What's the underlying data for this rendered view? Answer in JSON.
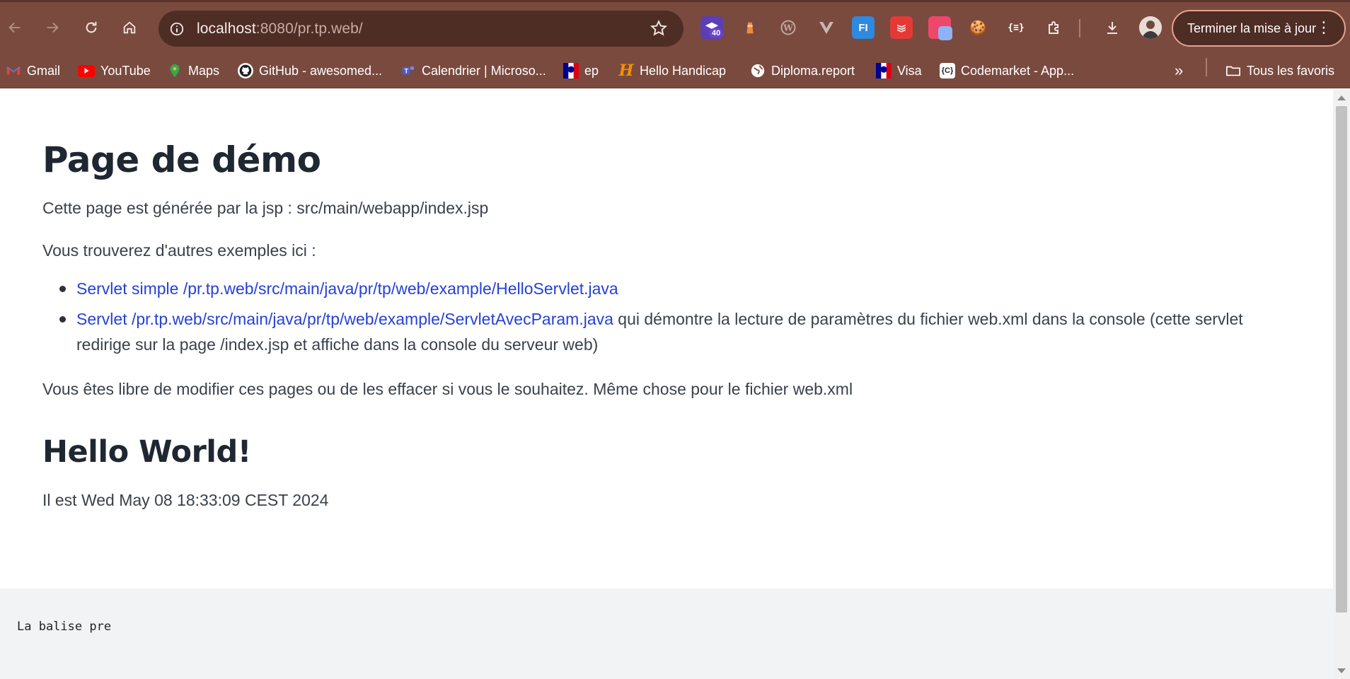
{
  "browser": {
    "url_host": "localhost",
    "url_rest": ":8080/pr.tp.web/",
    "extension_badge": "40",
    "update_button_label": "Terminer la mise à jour",
    "colors": {
      "chrome": "#7a4a3f",
      "omnibox": "#4e2d25",
      "update_border": "#e9a18f"
    }
  },
  "bookmarks": {
    "items": [
      {
        "label": "Gmail",
        "icon": "gmail-icon"
      },
      {
        "label": "YouTube",
        "icon": "youtube-icon"
      },
      {
        "label": "Maps",
        "icon": "maps-icon"
      },
      {
        "label": "GitHub - awesomed...",
        "icon": "github-icon"
      },
      {
        "label": "Calendrier | Microso...",
        "icon": "teams-icon"
      },
      {
        "label": "ep",
        "icon": "marianne-icon"
      },
      {
        "label": "Hello Handicap",
        "icon": "hello-handicap-icon"
      },
      {
        "label": "Diploma.report",
        "icon": "globe-icon"
      },
      {
        "label": "Visa",
        "icon": "marianne-icon"
      },
      {
        "label": "Codemarket - App...",
        "icon": "codemarket-icon"
      }
    ],
    "overflow": "»",
    "all_bookmarks_label": "Tous les favoris"
  },
  "page": {
    "title": "Page de démo",
    "intro": "Cette page est générée par la jsp : src/main/webapp/index.jsp",
    "examples_intro": "Vous trouverez d'autres exemples ici :",
    "links": [
      {
        "text": "Servlet simple /pr.tp.web/src/main/java/pr/tp/web/example/HelloServlet.java",
        "suffix": ""
      },
      {
        "text": "Servlet /pr.tp.web/src/main/java/pr/tp/web/example/ServletAvecParam.java",
        "suffix": " qui démontre la lecture de paramètres du fichier web.xml dans la console (cette servlet redirige sur la page /index.jsp et affiche dans la console du serveur web)"
      }
    ],
    "freedom_note": "Vous êtes libre de modifier ces pages ou de les effacer si vous le souhaitez. Même chose pour le fichier web.xml",
    "hello_heading": "Hello World!",
    "date_line": "Il est Wed May 08 18:33:09 CEST 2024",
    "pre_text": "La balise pre",
    "link_color": "#2541d6"
  }
}
